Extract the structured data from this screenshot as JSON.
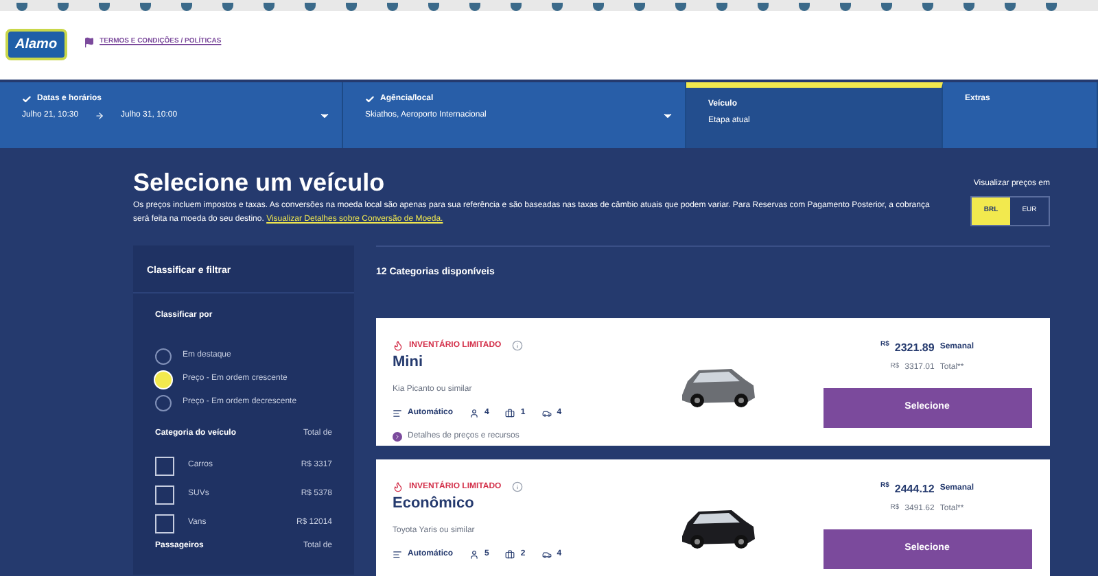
{
  "header": {
    "logo": "Alamo",
    "terms_link": "TERMOS E CONDIÇÕES / POLÍTICAS"
  },
  "steps": [
    {
      "title": "Datas e horários",
      "done": true,
      "selected": false,
      "values": [
        "Julho 21, 10:30",
        "Julho 31, 10:00"
      ]
    },
    {
      "title": "Agência/local",
      "done": true,
      "selected": false,
      "values": [
        "Skiathos, Aeroporto Internacional"
      ]
    },
    {
      "title": "Veículo",
      "done": false,
      "selected": true,
      "values": [
        "Etapa atual"
      ]
    },
    {
      "title": "Extras",
      "done": false,
      "selected": false
    }
  ],
  "page": {
    "title": "Selecione um veículo",
    "notice": "Os preços incluem impostos e taxas. As conversões na moeda local são apenas para sua referência e são baseadas nas taxas de câmbio atuais que podem variar. Para Reservas com Pagamento Posterior, a cobrança será feita na moeda do seu destino.",
    "notice_link": "Visualizar Detalhes sobre Conversão de Moeda.",
    "currency_label": "Visualizar preços em",
    "currencies": [
      {
        "label": "BRL",
        "selected": true
      },
      {
        "label": "EUR",
        "selected": false
      }
    ]
  },
  "filters": {
    "title": "Classificar e filtrar",
    "sort_title": "Classificar por",
    "sort_options": [
      {
        "label": "Em destaque",
        "selected": false
      },
      {
        "label": "Preço - Em ordem crescente",
        "selected": true
      },
      {
        "label": "Preço - Em ordem decrescente",
        "selected": false
      }
    ],
    "category_title": "Categoria do veículo",
    "category_total": "Total de",
    "categories": [
      {
        "label": "Carros",
        "price": "R$ 3317",
        "checked": false
      },
      {
        "label": "SUVs",
        "price": "R$ 5378",
        "checked": false
      },
      {
        "label": "Vans",
        "price": "R$ 12014",
        "checked": false
      }
    ],
    "passengers_title": "Passageiros",
    "passengers_total": "Total de"
  },
  "results": {
    "count": "12 Categorias disponíveis",
    "cars": [
      {
        "badge": "INVENTÁRIO LIMITADO",
        "name": "Mini",
        "model": "Kia Picanto ou similar",
        "transmission": "Automático",
        "seats": "4",
        "bags": "1",
        "doors": "4",
        "details": "Detalhes de preços e recursos",
        "weekly_currency": "R$",
        "weekly": "2321.89",
        "weekly_label": "Semanal",
        "total_currency": "R$",
        "total": "3317.01",
        "total_label": "Total**",
        "button": "Selecione",
        "color": "#6b6e73"
      },
      {
        "badge": "INVENTÁRIO LIMITADO",
        "name": "Econômico",
        "model": "Toyota Yaris ou similar",
        "transmission": "Automático",
        "seats": "5",
        "bags": "2",
        "doors": "4",
        "weekly_currency": "R$",
        "weekly": "2444.12",
        "weekly_label": "Semanal",
        "total_currency": "R$",
        "total": "3491.62",
        "total_label": "Total**",
        "button": "Selecione",
        "color": "#1c1c20"
      }
    ]
  }
}
